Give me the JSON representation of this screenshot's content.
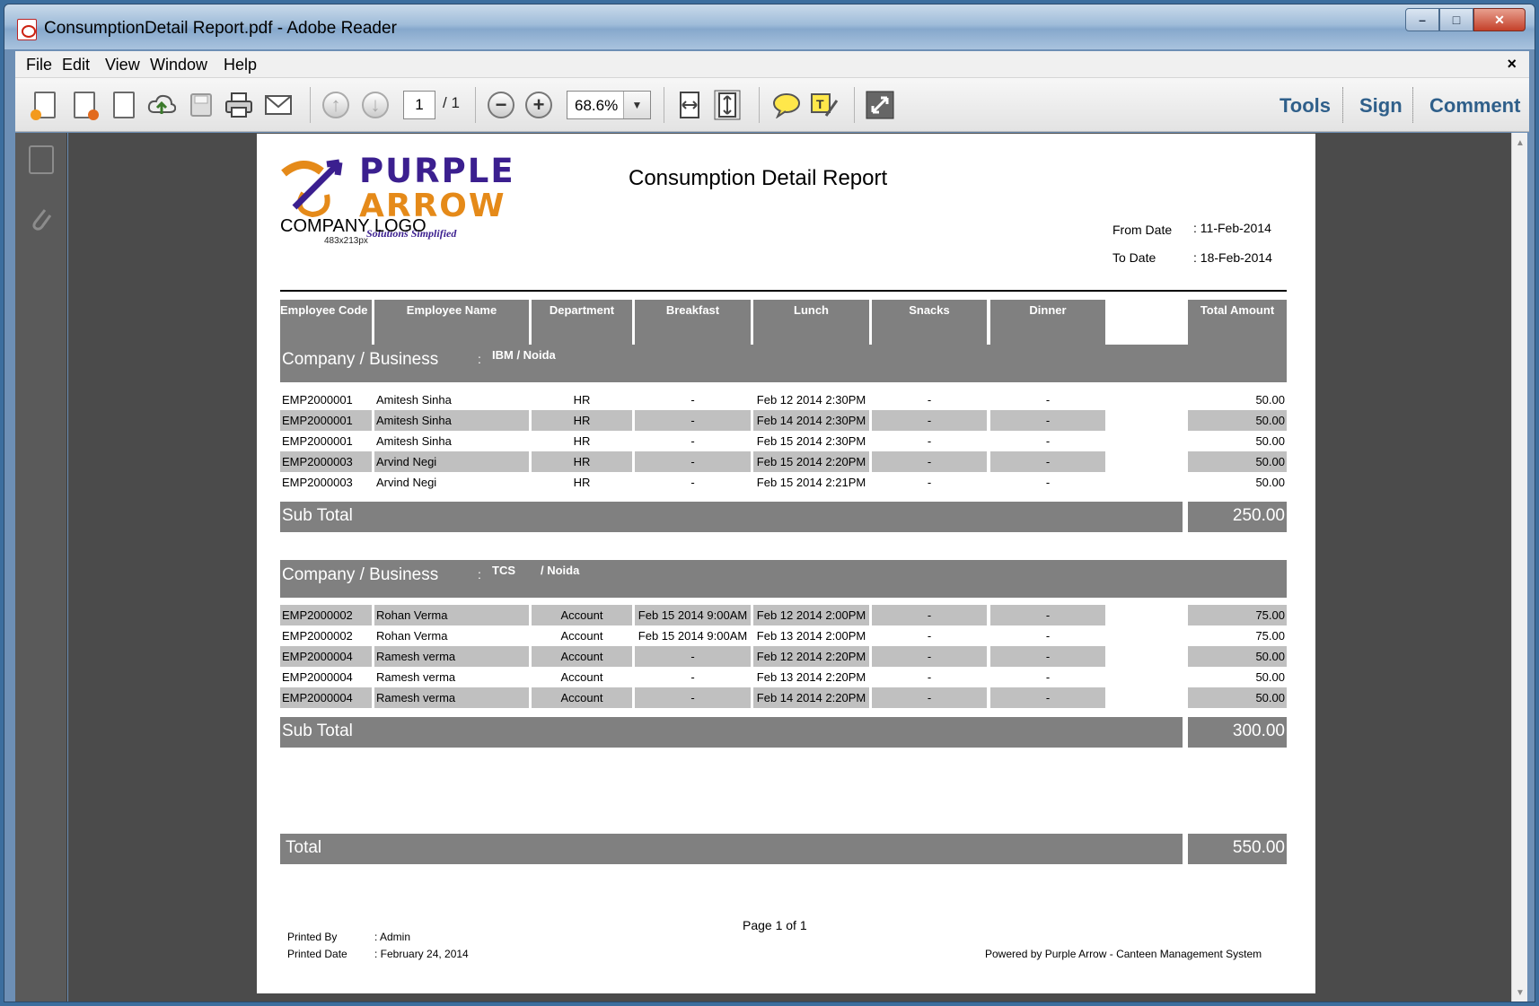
{
  "window": {
    "title": "ConsumptionDetail Report.pdf - Adobe Reader",
    "minimize": "–",
    "maximize": "□",
    "close": "✕"
  },
  "menu": {
    "items": [
      "File",
      "Edit",
      "View",
      "Window",
      "Help"
    ],
    "close": "×"
  },
  "toolbar": {
    "page_current": "1",
    "page_total": "/ 1",
    "zoom": "68.6%",
    "zoom_arrow": "▼",
    "zoom_out": "−",
    "zoom_in": "+",
    "prev_page": "↑",
    "next_page": "↓",
    "tools": "Tools",
    "sign": "Sign",
    "comment": "Comment"
  },
  "report": {
    "logo_line1": "PURPLE",
    "logo_line2": "ARROW",
    "logo_tagline": "Solutions Simplified",
    "logo_caption": "COMPANY LOGO",
    "logo_size": "483x213px",
    "title": "Consumption Detail  Report",
    "from_label": "From Date",
    "from_value": ": 11-Feb-2014",
    "to_label": "To Date",
    "to_value": ": 18-Feb-2014",
    "columns": [
      "Employee Code",
      "Employee Name",
      "Department",
      "Breakfast",
      "Lunch",
      "Snacks",
      "Dinner",
      "Total Amount"
    ],
    "groups": [
      {
        "label": "Company / Business",
        "colon": ":",
        "company": "IBM / Noida",
        "location": "",
        "rows": [
          [
            "EMP2000001",
            "Amitesh Sinha",
            "HR",
            "-",
            "Feb 12 2014  2:30PM",
            "-",
            "-",
            "50.00"
          ],
          [
            "EMP2000001",
            "Amitesh Sinha",
            "HR",
            "-",
            "Feb 14 2014  2:30PM",
            "-",
            "-",
            "50.00"
          ],
          [
            "EMP2000001",
            "Amitesh Sinha",
            "HR",
            "-",
            "Feb 15 2014  2:30PM",
            "-",
            "-",
            "50.00"
          ],
          [
            "EMP2000003",
            "Arvind  Negi",
            "HR",
            "-",
            "Feb 15 2014  2:20PM",
            "-",
            "-",
            "50.00"
          ],
          [
            "EMP2000003",
            "Arvind  Negi",
            "HR",
            "-",
            "Feb 15 2014  2:21PM",
            "-",
            "-",
            "50.00"
          ]
        ],
        "subtotal_label": "Sub Total",
        "subtotal": "250.00"
      },
      {
        "label": "Company / Business",
        "colon": ":",
        "company": "TCS",
        "location": "/ Noida",
        "rows": [
          [
            "EMP2000002",
            "Rohan Verma",
            "Account",
            "Feb 15 2014  9:00AM",
            "Feb 12 2014  2:00PM",
            "-",
            "-",
            "75.00"
          ],
          [
            "EMP2000002",
            "Rohan Verma",
            "Account",
            "Feb 15 2014  9:00AM",
            "Feb 13 2014  2:00PM",
            "-",
            "-",
            "75.00"
          ],
          [
            "EMP2000004",
            "Ramesh verma",
            "Account",
            "-",
            "Feb 12 2014  2:20PM",
            "-",
            "-",
            "50.00"
          ],
          [
            "EMP2000004",
            "Ramesh verma",
            "Account",
            "-",
            "Feb 13 2014  2:20PM",
            "-",
            "-",
            "50.00"
          ],
          [
            "EMP2000004",
            "Ramesh verma",
            "Account",
            "-",
            "Feb 14 2014  2:20PM",
            "-",
            "-",
            "50.00"
          ]
        ],
        "subtotal_label": "Sub Total",
        "subtotal": "300.00"
      }
    ],
    "total_label": "Total",
    "total": "550.00",
    "page_label": "Page 1 of 1",
    "printed_by_label": "Printed By",
    "printed_by_value": ": Admin",
    "printed_date_label": "Printed Date",
    "printed_date_value": ": February 24, 2014",
    "powered_by": "Powered by Purple Arrow - Canteen Management System"
  }
}
